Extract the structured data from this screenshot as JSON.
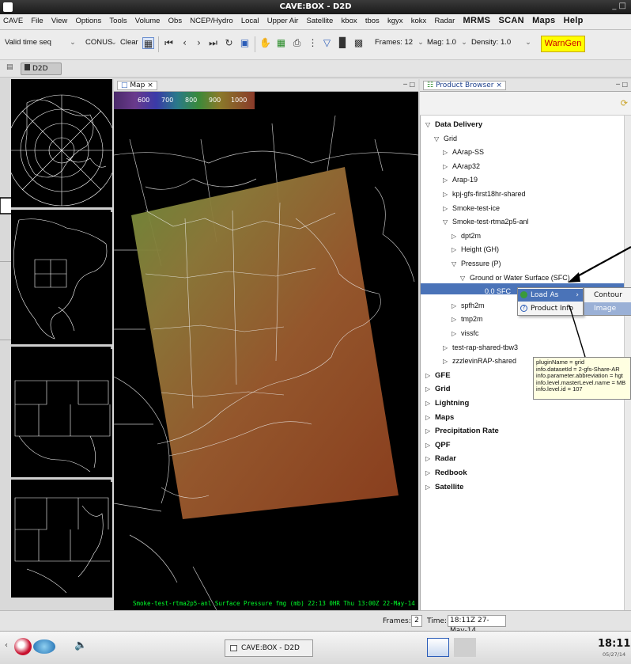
{
  "window": {
    "title": "CAVE:BOX - D2D",
    "controls": "_ □"
  },
  "menubar": {
    "items": [
      "CAVE",
      "File",
      "View",
      "Options",
      "Tools",
      "Volume",
      "Obs",
      "NCEP/Hydro",
      "Local",
      "Upper Air",
      "Satellite",
      "kbox",
      "tbos",
      "kgyx",
      "kokx",
      "Radar"
    ],
    "bold_items": [
      "MRMS",
      "SCAN",
      "Maps",
      "Help"
    ]
  },
  "toolbar": {
    "valid_time": "Valid time seq",
    "area": "CONUS",
    "clear": "Clear",
    "frames": "Frames: 12",
    "mag": "Mag: 1.0",
    "density": "Density: 1.0",
    "warngen": "WarnGen",
    "dropdown_glyph": "⌄"
  },
  "perspective": {
    "tab": "D2D"
  },
  "map": {
    "tab_label": "Map",
    "colorbar": [
      "600",
      "700",
      "800",
      "900",
      "1000"
    ],
    "status": "Smoke-test-rtma2p5-anl Surface Pressure fmg (mb)   22:13   0HR Thu 13:00Z 22-May-14"
  },
  "product_browser": {
    "tab_label": "Product Browser",
    "tree": [
      {
        "label": "Data Delivery",
        "level": 0,
        "toggle": "▽",
        "bold": true
      },
      {
        "label": "Grid",
        "level": 1,
        "toggle": "▽",
        "bold": false
      },
      {
        "label": "AArap-SS",
        "level": 2,
        "toggle": "▷",
        "bold": false
      },
      {
        "label": "AArap32",
        "level": 2,
        "toggle": "▷",
        "bold": false
      },
      {
        "label": "Arap-19",
        "level": 2,
        "toggle": "▷",
        "bold": false
      },
      {
        "label": "kpj-gfs-first18hr-shared",
        "level": 2,
        "toggle": "▷",
        "bold": false
      },
      {
        "label": "Smoke-test-ice",
        "level": 2,
        "toggle": "▷",
        "bold": false
      },
      {
        "label": "Smoke-test-rtma2p5-anl",
        "level": 2,
        "toggle": "▽",
        "bold": false
      },
      {
        "label": "dpt2m",
        "level": 3,
        "toggle": "▷",
        "bold": false
      },
      {
        "label": "Height (GH)",
        "level": 3,
        "toggle": "▷",
        "bold": false
      },
      {
        "label": "Pressure (P)",
        "level": 3,
        "toggle": "▽",
        "bold": false
      },
      {
        "label": "Ground or Water Surface (SFC)",
        "level": 4,
        "toggle": "▽",
        "bold": false
      },
      {
        "label": "0.0 SFC",
        "level": 5,
        "toggle": "",
        "bold": false,
        "selected": true
      },
      {
        "label": "spfh2m",
        "level": 3,
        "toggle": "▷",
        "bold": false
      },
      {
        "label": "tmp2m",
        "level": 3,
        "toggle": "▷",
        "bold": false
      },
      {
        "label": "vissfc",
        "level": 3,
        "toggle": "▷",
        "bold": false
      },
      {
        "label": "test-rap-shared-tbw3",
        "level": 2,
        "toggle": "▷",
        "bold": false
      },
      {
        "label": "zzzlevinRAP-shared",
        "level": 2,
        "toggle": "▷",
        "bold": false
      },
      {
        "label": "GFE",
        "level": 0,
        "toggle": "▷",
        "bold": true
      },
      {
        "label": "Grid",
        "level": 0,
        "toggle": "▷",
        "bold": true
      },
      {
        "label": "Lightning",
        "level": 0,
        "toggle": "▷",
        "bold": true
      },
      {
        "label": "Maps",
        "level": 0,
        "toggle": "▷",
        "bold": true
      },
      {
        "label": "Precipitation Rate",
        "level": 0,
        "toggle": "▷",
        "bold": true
      },
      {
        "label": "QPF",
        "level": 0,
        "toggle": "▷",
        "bold": true
      },
      {
        "label": "Radar",
        "level": 0,
        "toggle": "▷",
        "bold": true
      },
      {
        "label": "Redbook",
        "level": 0,
        "toggle": "▷",
        "bold": true
      },
      {
        "label": "Satellite",
        "level": 0,
        "toggle": "▷",
        "bold": true
      }
    ],
    "context_menu": {
      "load_as": "Load As",
      "product_info": "Product Info",
      "submenu_arrow": "›"
    },
    "submenu": {
      "contour": "Contour",
      "image": "Image"
    },
    "tooltip": [
      "pluginName = grid",
      "info.datasetId = 2-gfs-Share-AR",
      "info.parameter.abbreviation = hgt",
      "info.level.masterLevel.name = MB",
      "info.level.id = 107"
    ]
  },
  "statusbar": {
    "frames_label": "Frames:",
    "frames_value": "2",
    "time_label": "Time:",
    "time_value": "18:11Z 27-May-14"
  },
  "taskbar": {
    "task": "CAVE:BOX - D2D",
    "clock": "18:11",
    "date": "05/27/14"
  }
}
